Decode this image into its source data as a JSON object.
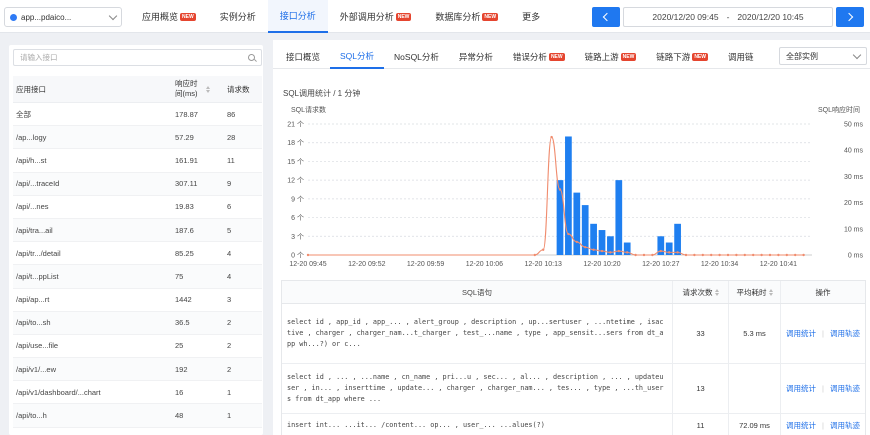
{
  "nav": {
    "app_name": "app...pdaico...",
    "items": [
      {
        "label": "应用概览",
        "badge": "NEW",
        "active": false
      },
      {
        "label": "实例分析",
        "badge": "",
        "active": false
      },
      {
        "label": "接口分析",
        "badge": "",
        "active": true
      },
      {
        "label": "外部调用分析",
        "badge": "NEW",
        "active": false
      },
      {
        "label": "数据库分析",
        "badge": "NEW",
        "active": false
      },
      {
        "label": "更多",
        "badge": "",
        "active": false
      }
    ],
    "time_start": "2020/12/20 09:45",
    "time_sep": "-",
    "time_end": "2020/12/20 10:45"
  },
  "left": {
    "search_placeholder": "请输入接口",
    "columns": [
      "应用接口",
      "响应时间(ms)",
      "请求数"
    ],
    "rows": [
      {
        "name": "全部",
        "rt": "178.87",
        "count": "86"
      },
      {
        "name": "/ap...logy",
        "rt": "57.29",
        "count": "28"
      },
      {
        "name": "/api/h...st",
        "rt": "161.91",
        "count": "11"
      },
      {
        "name": "/api/...traceId",
        "rt": "307.11",
        "count": "9"
      },
      {
        "name": "/api/...nes",
        "rt": "19.83",
        "count": "6"
      },
      {
        "name": "/api/tra...ail",
        "rt": "187.6",
        "count": "5"
      },
      {
        "name": "/api/tr.../detail",
        "rt": "85.25",
        "count": "4"
      },
      {
        "name": "/api/t...ppList",
        "rt": "75",
        "count": "4"
      },
      {
        "name": "/api/ap...rt",
        "rt": "1442",
        "count": "3"
      },
      {
        "name": "/api/to...sh",
        "rt": "36.5",
        "count": "2"
      },
      {
        "name": "/api/use...file",
        "rt": "25",
        "count": "2"
      },
      {
        "name": "/api/v1/...ew",
        "rt": "192",
        "count": "2"
      },
      {
        "name": "/api/v1/dashboard/...chart",
        "rt": "16",
        "count": "1"
      },
      {
        "name": "/api/to...h",
        "rt": "48",
        "count": "1"
      }
    ]
  },
  "right": {
    "tabs": [
      {
        "label": "接口概览",
        "badge": "",
        "active": false
      },
      {
        "label": "SQL分析",
        "badge": "",
        "active": true
      },
      {
        "label": "NoSQL分析",
        "badge": "",
        "active": false
      },
      {
        "label": "异常分析",
        "badge": "",
        "active": false
      },
      {
        "label": "错误分析",
        "badge": "NEW",
        "active": false
      },
      {
        "label": "链路上游",
        "badge": "NEW",
        "active": false
      },
      {
        "label": "链路下游",
        "badge": "NEW",
        "active": false
      },
      {
        "label": "调用链",
        "badge": "",
        "active": false
      }
    ],
    "instance_select": "全部实例",
    "chart_title": "SQL调用统计 / 1 分钟",
    "table": {
      "columns": [
        "SQL语句",
        "请求次数",
        "平均耗时",
        "操作"
      ],
      "rows": [
        {
          "sql": "select id , app_id , app_... , alert_group , description , up...sertuser , ...ntetime , isactive , charger , charger_nam...t_charger , test_...name , type , app_sensit...sers from dt_app wh...?) or c...",
          "count": "33",
          "avg": "5.3 ms",
          "op1": "调用统计",
          "op2": "调用轨迹"
        },
        {
          "sql": "select id , ... , ...name , cn_name , pri...u , sec... , al... , description , ... , updateuser , in... , inserttime , update... , charger , charger_nam... , tes... , type , ...th_users from dt_app where ...",
          "count": "13",
          "avg": "",
          "op1": "调用统计",
          "op2": "调用轨迹"
        },
        {
          "sql": "insert int... ...it... /content... op... , user_... ...alues(?)",
          "count": "11",
          "avg": "72.09 ms",
          "op1": "调用统计",
          "op2": "调用轨迹"
        }
      ]
    }
  },
  "chart_data": {
    "type": "bar",
    "left_axis_label": "SQL请求数",
    "right_axis_label": "SQL响应时间",
    "y_left_ticks": [
      "21 个",
      "18 个",
      "15 个",
      "12 个",
      "9 个",
      "6 个",
      "3 个",
      "0 个"
    ],
    "y_right_ticks": [
      "50 ms",
      "40 ms",
      "30 ms",
      "20 ms",
      "10 ms",
      "0 ms"
    ],
    "x_ticks": [
      "12-20 09:45",
      "12-20 09:52",
      "12-20 09:59",
      "12-20 10:06",
      "12-20 10:13",
      "12-20 10:20",
      "12-20 10:27",
      "12-20 10:34",
      "12-20 10:41"
    ],
    "ylim_left": [
      0,
      21
    ],
    "ylim_right": [
      0,
      50
    ],
    "bar_color": "#1f7ff0",
    "line_color": "#f08c6e",
    "x_minutes": [
      30,
      31,
      32,
      33,
      34,
      35,
      36,
      37,
      38,
      42,
      43,
      44
    ],
    "bar_values": [
      12,
      19,
      10,
      8,
      5,
      4,
      3,
      12,
      2,
      3,
      2,
      5
    ],
    "line_minutes": [
      0,
      27,
      28,
      29,
      30,
      31,
      32,
      33,
      34,
      35,
      36,
      37,
      38,
      39,
      40,
      41,
      42,
      43,
      44,
      45,
      46,
      47,
      48,
      49,
      50,
      51,
      52,
      53,
      54,
      55,
      56,
      57,
      58,
      59
    ],
    "line_values": [
      0,
      0,
      2,
      45,
      25,
      8,
      5,
      3,
      2,
      1.5,
      1,
      1.5,
      1,
      0,
      0,
      0,
      1.5,
      1,
      1,
      0,
      0,
      0,
      0,
      0,
      0,
      0,
      0,
      0,
      0,
      0,
      0,
      0,
      0,
      0
    ]
  }
}
